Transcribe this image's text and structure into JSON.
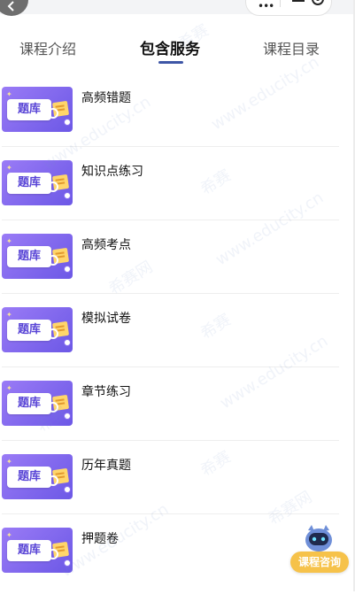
{
  "tabs": [
    {
      "label": "课程介绍"
    },
    {
      "label": "包含服务"
    },
    {
      "label": "课程目录"
    }
  ],
  "active_tab": "包含服务",
  "thumbnail_text": "题库",
  "items": [
    {
      "title": "高频错题"
    },
    {
      "title": "知识点练习"
    },
    {
      "title": "高频考点"
    },
    {
      "title": "模拟试卷"
    },
    {
      "title": "章节练习"
    },
    {
      "title": "历年真题"
    },
    {
      "title": "押题卷"
    }
  ],
  "consult_button": {
    "label": "课程咨询"
  },
  "watermarks": {
    "brand": "希赛",
    "site": "www.educity.cn",
    "net": "希赛网"
  },
  "colors": {
    "accent": "#3e56a6",
    "thumb_purple": "#7b62ee",
    "consult_yellow": "#f6c24a"
  }
}
